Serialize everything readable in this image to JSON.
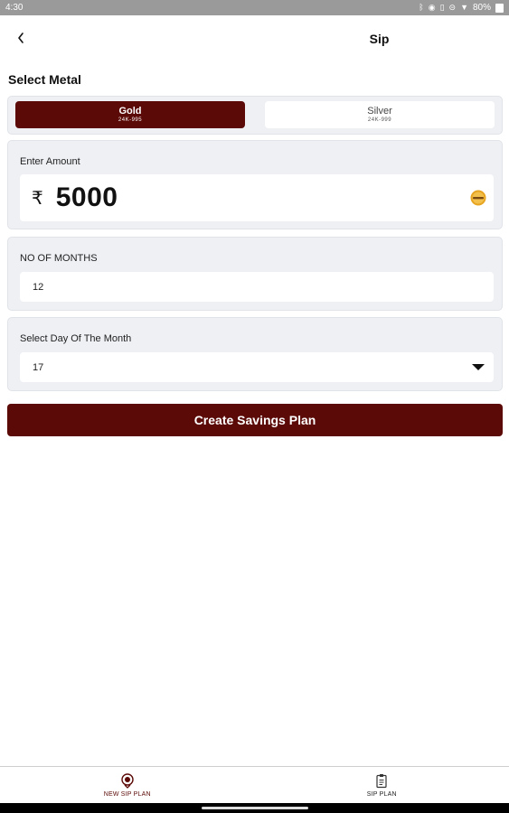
{
  "status_bar": {
    "time": "4:30",
    "battery": "80%"
  },
  "app_bar": {
    "back_glyph": "‹",
    "title": "Sip"
  },
  "metal_section": {
    "title": "Select Metal",
    "options": [
      {
        "name": "Gold",
        "purity": "24K-995",
        "selected": true
      },
      {
        "name": "Silver",
        "purity": "24K-999",
        "selected": false
      }
    ]
  },
  "amount": {
    "label": "Enter Amount",
    "currency_symbol": "₹",
    "value": "5000",
    "icon": "gold-coin-icon"
  },
  "months": {
    "label": "NO OF MONTHS",
    "value": "12"
  },
  "day_of_month": {
    "label": "Select Day Of The Month",
    "value": "17"
  },
  "create_button": {
    "label": "Create Savings Plan"
  },
  "bottom_nav": [
    {
      "label": "NEW SIP PLAN",
      "icon": "sip-coin-icon",
      "active": true
    },
    {
      "label": "SIP PLAN",
      "icon": "clipboard-icon",
      "active": false
    }
  ],
  "colors": {
    "primary": "#5b0a07",
    "card_bg": "#eef0f4",
    "status_bar": "#9a9a9a"
  }
}
